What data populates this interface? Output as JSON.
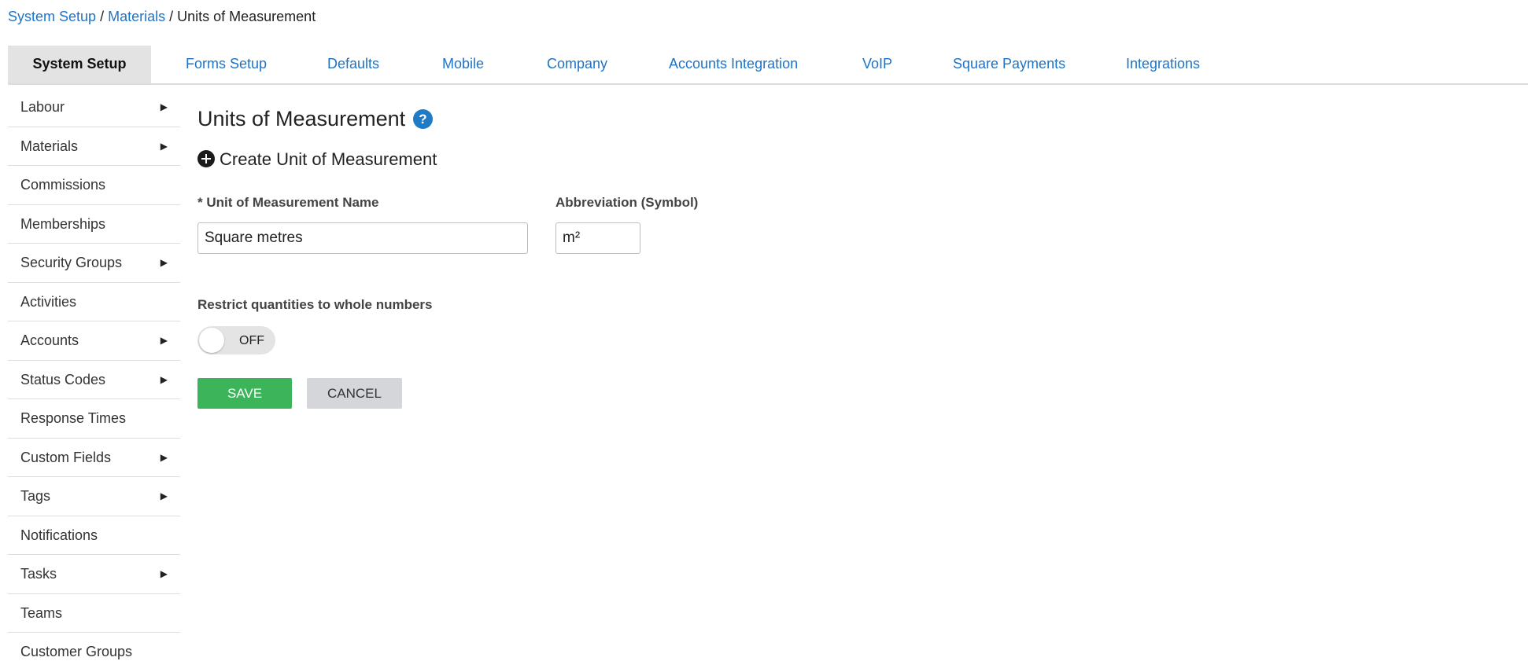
{
  "breadcrumb": {
    "items": [
      {
        "label": "System Setup"
      },
      {
        "label": "Materials"
      },
      {
        "label": "Units of Measurement"
      }
    ],
    "separator": "/"
  },
  "tabs": [
    {
      "label": "System Setup",
      "active": true
    },
    {
      "label": "Forms Setup"
    },
    {
      "label": "Defaults"
    },
    {
      "label": "Mobile"
    },
    {
      "label": "Company"
    },
    {
      "label": "Accounts Integration"
    },
    {
      "label": "VoIP"
    },
    {
      "label": "Square Payments"
    },
    {
      "label": "Integrations"
    }
  ],
  "sidebar": {
    "items": [
      {
        "label": "Labour",
        "submenu": true
      },
      {
        "label": "Materials",
        "submenu": true
      },
      {
        "label": "Commissions",
        "submenu": false
      },
      {
        "label": "Memberships",
        "submenu": false
      },
      {
        "label": "Security Groups",
        "submenu": true
      },
      {
        "label": "Activities",
        "submenu": false
      },
      {
        "label": "Accounts",
        "submenu": true
      },
      {
        "label": "Status Codes",
        "submenu": true
      },
      {
        "label": "Response Times",
        "submenu": false
      },
      {
        "label": "Custom Fields",
        "submenu": true
      },
      {
        "label": "Tags",
        "submenu": true
      },
      {
        "label": "Notifications",
        "submenu": false
      },
      {
        "label": "Tasks",
        "submenu": true
      },
      {
        "label": "Teams",
        "submenu": false
      },
      {
        "label": "Customer Groups",
        "submenu": false
      }
    ],
    "caret_glyph": "▶"
  },
  "main": {
    "title": "Units of Measurement",
    "help_glyph": "?",
    "create_label": "Create Unit of Measurement",
    "name_field": {
      "label": "* Unit of Measurement Name",
      "value": "Square metres"
    },
    "abbrev_field": {
      "label": "Abbreviation (Symbol)",
      "value": "m²"
    },
    "restrict": {
      "label": "Restrict quantities to whole numbers",
      "toggle_text": "OFF",
      "on": false
    },
    "save_label": "SAVE",
    "cancel_label": "CANCEL"
  },
  "colors": {
    "link": "#1f73c7",
    "save": "#3cb45a",
    "cancel": "#d4d6d9",
    "help": "#1f7bc6"
  },
  "icons": {
    "help": "help-icon",
    "create": "plus-circle-icon",
    "caret": "caret-right-icon"
  }
}
